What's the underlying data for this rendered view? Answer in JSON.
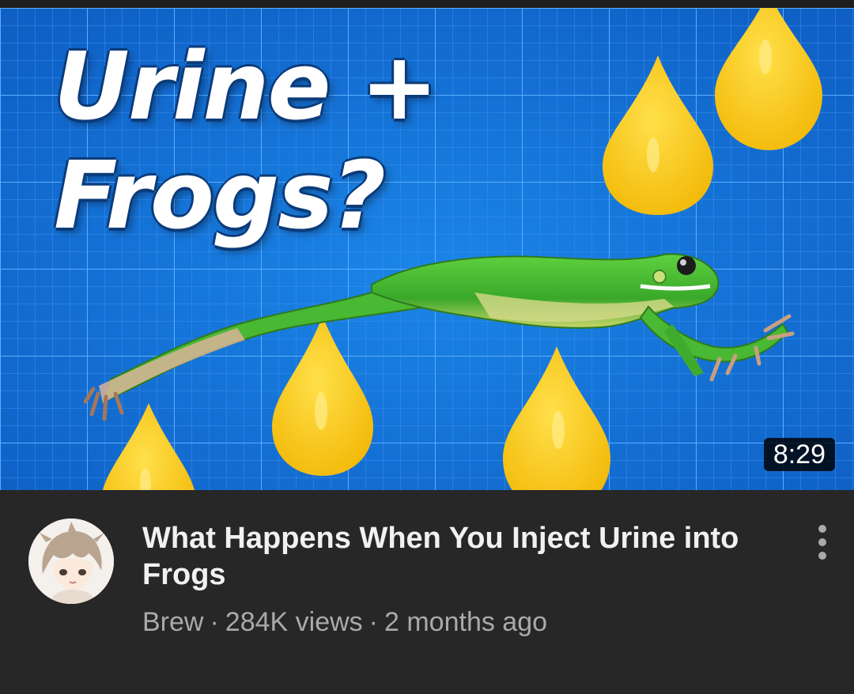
{
  "thumbnail": {
    "overlay_line1": "Urine +",
    "overlay_line2": "Frogs?",
    "duration": "8:29",
    "colors": {
      "background": "#1677d6",
      "grid": "#4fa3ff",
      "droplet": "#f7c614",
      "frog": "#4cc23a"
    }
  },
  "video": {
    "title": "What Happens When You Inject Urine into Frogs",
    "channel": "Brew",
    "separator": "·",
    "views": "284K views",
    "age": "2 months ago"
  },
  "icons": {
    "more": "more-vert-icon",
    "avatar": "channel-avatar"
  }
}
